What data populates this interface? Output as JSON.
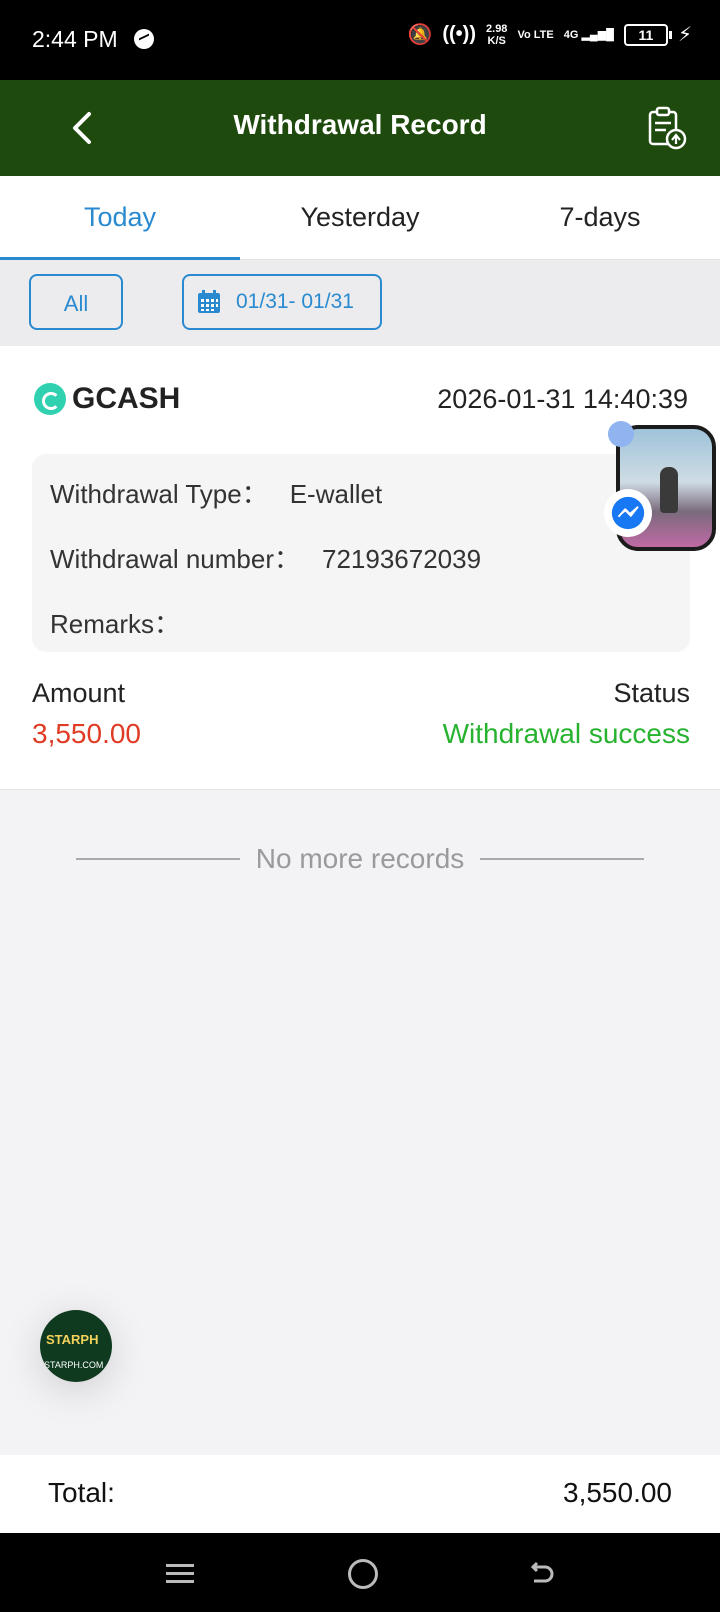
{
  "status_bar": {
    "time": "2:44 PM",
    "net_speed": "2.98",
    "net_unit": "K/S",
    "volte": "Vo LTE",
    "signal": "4G",
    "battery": "11"
  },
  "header": {
    "title": "Withdrawal Record"
  },
  "tabs": [
    {
      "label": "Today",
      "active": true
    },
    {
      "label": "Yesterday",
      "active": false
    },
    {
      "label": "7-days",
      "active": false
    }
  ],
  "filters": {
    "all_label": "All",
    "date_range": "01/31- 01/31"
  },
  "record": {
    "brand": "GCASH",
    "datetime": "2026-01-31 14:40:39",
    "type_label": "Withdrawal Type：",
    "type_value": "E-wallet",
    "number_label": "Withdrawal number：",
    "number_value": "72193672039",
    "remarks_label": "Remarks：",
    "amount_label": "Amount",
    "amount_value": "3,550.00",
    "status_label": "Status",
    "status_value": "Withdrawal success"
  },
  "no_more": "No more records",
  "floating": {
    "starph_logo": "STARPH",
    "starph_url": "STARPH.COM"
  },
  "total": {
    "label": "Total:",
    "value": "3,550.00"
  },
  "colors": {
    "header_bg": "#1f4a0e",
    "accent": "#2a8ad0",
    "amount": "#e03b24",
    "success": "#27b32f"
  }
}
